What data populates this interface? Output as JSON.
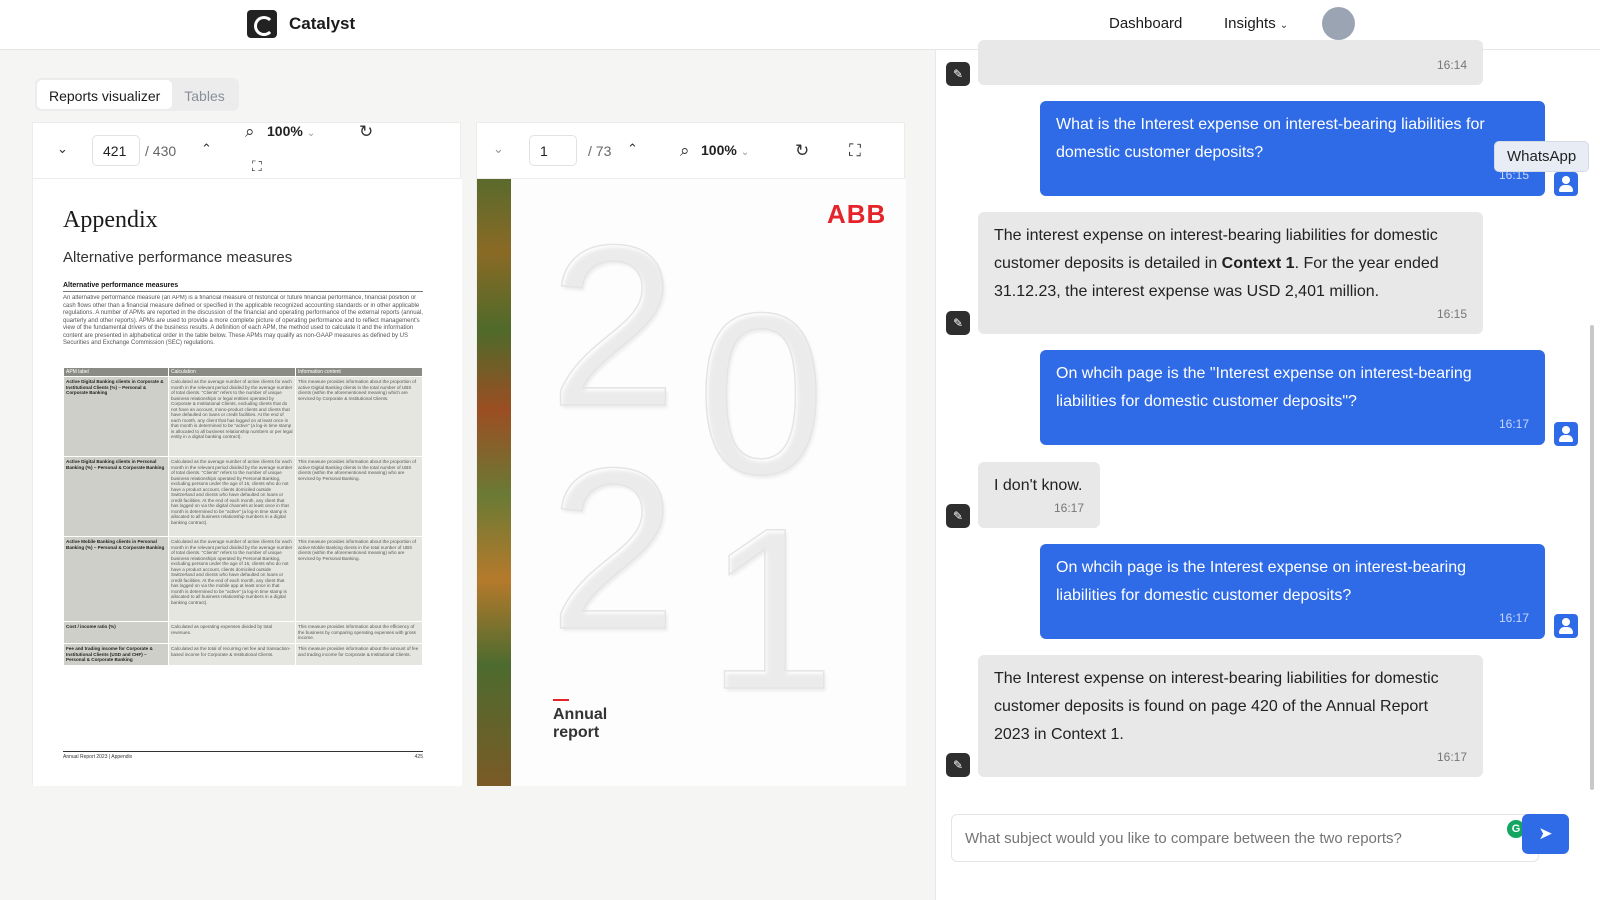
{
  "app": {
    "name": "Catalyst"
  },
  "nav": {
    "dashboard": "Dashboard",
    "insights": "Insights"
  },
  "tabs": [
    "Reports visualizer",
    "Tables"
  ],
  "viewer_left": {
    "page": "421",
    "total": "/ 430",
    "zoom": "100%",
    "doc": {
      "title": "Appendix",
      "subtitle": "Alternative performance measures",
      "heading": "Alternative performance measures",
      "paragraph": "An alternative performance measure (an APM) is a financial measure of historical or future financial performance, financial position or cash flows other than a financial measure defined or specified in the applicable recognized accounting standards or in other applicable regulations. A number of APMs are reported in the discussion of the financial and operating performance of the external reports (annual, quarterly and other reports). APMs are used to provide a more complete picture of operating performance and to reflect management's view of the fundamental drivers of the business results. A definition of each APM, the method used to calculate it and the information content are presented in alphabetical order in the table below. These APMs may qualify as non-GAAP measures as defined by US Securities and Exchange Commission (SEC) regulations.",
      "table_headers": [
        "APM label",
        "Calculation",
        "Information content"
      ],
      "table_rows": [
        [
          "Active Digital Banking clients in Corporate & Institutional Clients (%) – Personal & Corporate Banking",
          "Calculated as the average number of active clients for each month in the relevant period divided by the average number of total clients. \"Clients\" refers to the number of unique business relationships or legal entities operated by Corporate & Institutional Clients, excluding clients that do not have an account, mono-product clients and clients that have defaulted on loans or credit facilities. At the end of each month, any client that has logged on at least once in that month is determined to be \"active\" (a log-in time stamp is allocated to all business relationship numbers or per legal entity in a digital banking contract).",
          "This measure provides information about the proportion of active Digital Banking clients in the total number of UBS clients (within the aforementioned meaning) which are serviced by Corporate & Institutional Clients."
        ],
        [
          "Active Digital Banking clients in Personal Banking (%) – Personal & Corporate Banking",
          "Calculated as the average number of active clients for each month in the relevant period divided by the average number of total clients. \"Clients\" refers to the number of unique business relationships operated by Personal Banking, excluding persons under the age of 15, clients who do not have a product account, clients domiciled outside Switzerland and clients who have defaulted on loans or credit facilities. At the end of each month, any client that has logged on via the digital channels at least once in that month is determined to be \"active\" (a log-in time stamp is allocated to all business relationship numbers in a digital banking contract).",
          "This measure provides information about the proportion of active Digital Banking clients in the total number of UBS clients (within the aforementioned meaning) who are serviced by Personal Banking."
        ],
        [
          "Active Mobile Banking clients in Personal Banking (%) – Personal & Corporate Banking",
          "Calculated as the average number of active clients for each month in the relevant period divided by the average number of total clients. \"Clients\" refers to the number of unique business relationships operated by Personal Banking, excluding persons under the age of 15, clients who do not have a product account, clients domiciled outside Switzerland and clients who have defaulted on loans or credit facilities. At the end of each month, any client that has logged on via the mobile app at least once in that month is determined to be \"active\" (a log-in time stamp is allocated to all business relationship numbers in a digital banking contract).",
          "This measure provides information about the proportion of active Mobile Banking clients in the total number of UBS clients (within the aforementioned meaning) who are serviced by Personal Banking."
        ],
        [
          "Cost / income ratio (%)",
          "Calculated as operating expenses divided by total revenues.",
          "This measure provides information about the efficiency of the business by comparing operating expenses with gross income."
        ],
        [
          "Fee and trading income for Corporate & Institutional Clients (USD and CHF) – Personal & Corporate Banking",
          "Calculated as the total of recurring net fee and transaction-based income for Corporate & Institutional Clients.",
          "This measure provides information about the amount of fee and trading income for Corporate & Institutional Clients."
        ]
      ],
      "footer_left": "Annual Report 2023 | Appendix",
      "footer_right": "425"
    }
  },
  "viewer_right": {
    "page": "1",
    "total": "/ 73",
    "zoom": "100%",
    "cover": {
      "brand": "ABB",
      "year_digits": [
        "2",
        "0",
        "2",
        "1"
      ],
      "label": "Annual report"
    }
  },
  "chat": {
    "messages": [
      {
        "role": "bot",
        "text": "",
        "time": "16:14"
      },
      {
        "role": "user",
        "text": "What is the Interest expense on interest-bearing liabilities for domestic customer deposits?",
        "time": "16:15"
      },
      {
        "role": "bot",
        "text_before": "The interest expense on interest-bearing liabilities for domestic customer deposits is detailed in ",
        "text_bold": "Context 1",
        "text_after": ". For the year ended 31.12.23, the interest expense was USD 2,401 million.",
        "time": "16:15"
      },
      {
        "role": "user",
        "text": "On whcih page is the \"Interest expense on interest-bearing liabilities for domestic customer deposits\"?",
        "time": "16:17"
      },
      {
        "role": "bot",
        "text": "I don't know.",
        "time": "16:17"
      },
      {
        "role": "user",
        "text": "On whcih page is the Interest expense on interest-bearing liabilities for domestic customer deposits?",
        "time": "16:17"
      },
      {
        "role": "bot",
        "text": "The Interest expense on interest-bearing liabilities for domestic customer deposits is found on page 420 of the Annual Report 2023 in Context 1.",
        "time": "16:17"
      }
    ],
    "tooltip": "WhatsApp",
    "input_placeholder": "What subject would you like to compare between the two reports?"
  },
  "icons": {
    "logo": "catalyst-logo-icon",
    "search": "search-icon",
    "rotate": "rotate-icon",
    "fullscreen": "fullscreen-icon",
    "bot": "feather-icon",
    "user": "user-icon",
    "send": "send-icon"
  },
  "colors": {
    "primary": "#2f6be6",
    "bot_bubble": "#e8e8e8",
    "abb_red": "#e4232b"
  }
}
